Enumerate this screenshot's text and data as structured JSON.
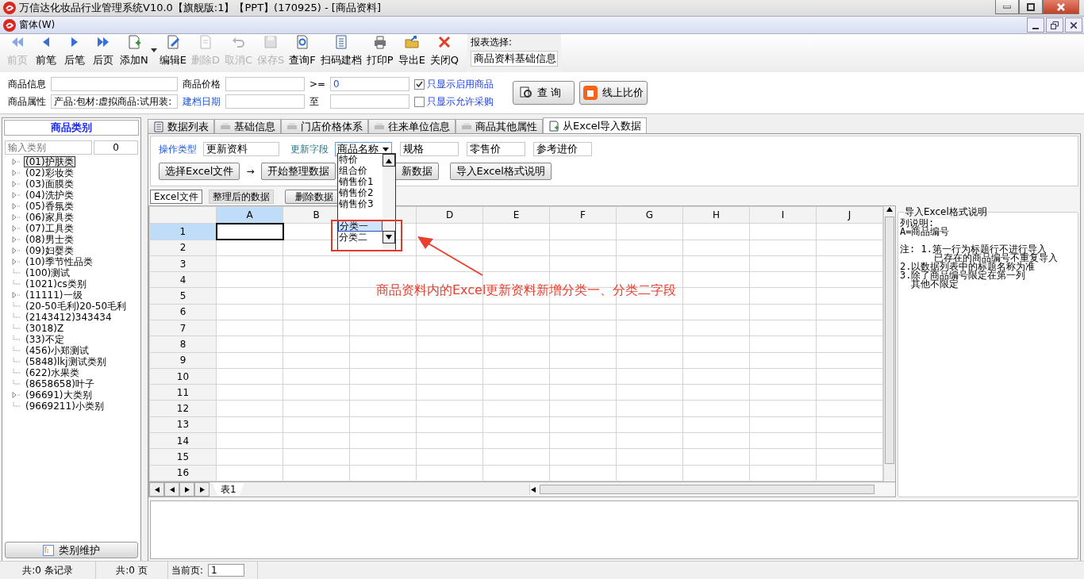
{
  "window": {
    "title": "万信达化妆品行业管理系统V10.0【旗舰版:1】【PPT】(170925) - [商品资料]"
  },
  "menu": {
    "label": "窗体(W)"
  },
  "toolbar": [
    {
      "kind": "first",
      "label": "前页",
      "disabled": true
    },
    {
      "kind": "prev",
      "label": "前笔",
      "disabled": false
    },
    {
      "kind": "next",
      "label": "后笔",
      "disabled": false
    },
    {
      "kind": "last",
      "label": "后页",
      "disabled": false
    },
    {
      "kind": "add",
      "label": "添加N",
      "disabled": false
    },
    {
      "kind": "edit",
      "label": "编辑E",
      "disabled": false
    },
    {
      "kind": "delete",
      "label": "删除D",
      "disabled": true
    },
    {
      "kind": "undo",
      "label": "取消C",
      "disabled": true
    },
    {
      "kind": "save",
      "label": "保存S",
      "disabled": true
    },
    {
      "kind": "query",
      "label": "查询F",
      "disabled": false
    },
    {
      "kind": "scan",
      "label": "扫码建档",
      "disabled": false
    },
    {
      "kind": "print",
      "label": "打印P",
      "disabled": false
    },
    {
      "kind": "export",
      "label": "导出E",
      "disabled": false
    },
    {
      "kind": "close",
      "label": "关闭Q",
      "disabled": false
    }
  ],
  "report_select": {
    "label": "报表选择:",
    "value": "商品资料基础信息"
  },
  "filters": {
    "info_label": "商品信息",
    "price_label": "商品价格",
    "ge": ">=",
    "ge_value": "0",
    "attr_label": "商品属性",
    "attr_value": "产品:包材:虚拟商品:试用装:",
    "date_label": "建档日期",
    "to": "至",
    "checks": [
      {
        "label": "只显示启用商品",
        "checked": true
      },
      {
        "label": "只显示允许采购",
        "checked": false
      }
    ],
    "query_button": "查  询",
    "compare_button": "线上比价"
  },
  "sidebar": {
    "title": "商品类别",
    "search_placeholder": "输入类别",
    "count": "0",
    "items": [
      {
        "label": "(01)护肤类",
        "kind": "folder",
        "selected": true
      },
      {
        "label": "(02)彩妆类",
        "kind": "folder",
        "selected": false
      },
      {
        "label": "(03)面膜类",
        "kind": "folder",
        "selected": false
      },
      {
        "label": "(04)洗护类",
        "kind": "folder",
        "selected": false
      },
      {
        "label": "(05)香氛类",
        "kind": "folder",
        "selected": false
      },
      {
        "label": "(06)家具类",
        "kind": "folder",
        "selected": false
      },
      {
        "label": "(07)工具类",
        "kind": "folder",
        "selected": false
      },
      {
        "label": "(08)男士类",
        "kind": "folder",
        "selected": false
      },
      {
        "label": "(09)妇婴类",
        "kind": "folder",
        "selected": false
      },
      {
        "label": "(10)季节性品类",
        "kind": "folder",
        "selected": false
      },
      {
        "label": "(100)测试",
        "kind": "leaf",
        "selected": false
      },
      {
        "label": "(1021)cs类别",
        "kind": "leaf",
        "selected": false
      },
      {
        "label": "(11111)一级",
        "kind": "folder",
        "selected": false
      },
      {
        "label": "(20-50毛利)20-50毛利",
        "kind": "leaf",
        "selected": false
      },
      {
        "label": "(2143412)343434",
        "kind": "leaf",
        "selected": false
      },
      {
        "label": "(3018)Z",
        "kind": "leaf",
        "selected": false
      },
      {
        "label": "(33)不定",
        "kind": "leaf",
        "selected": false
      },
      {
        "label": "(456)小郑测试",
        "kind": "leaf",
        "selected": false
      },
      {
        "label": "(5848)lkj测试类别",
        "kind": "leaf",
        "selected": false
      },
      {
        "label": "(622)水果类",
        "kind": "leaf",
        "selected": false
      },
      {
        "label": "(8658658)叶子",
        "kind": "leaf",
        "selected": false
      },
      {
        "label": "(96691)大类别",
        "kind": "folder",
        "selected": false
      },
      {
        "label": "(9669211)小类别",
        "kind": "leaf",
        "selected": false
      }
    ],
    "maintain_button": "类别维护"
  },
  "tabs": [
    {
      "label": "数据列表",
      "selected": false
    },
    {
      "label": "基础信息",
      "selected": false
    },
    {
      "label": "门店价格体系",
      "selected": false
    },
    {
      "label": "往来单位信息",
      "selected": false
    },
    {
      "label": "商品其他属性",
      "selected": false
    },
    {
      "label": "从Excel导入数据",
      "selected": true
    }
  ],
  "import": {
    "op_label": "操作类型",
    "op_value": "更新资料",
    "field_label": "更新字段",
    "field_value": "商品名称",
    "extra_fields": [
      "规格",
      "零售价",
      "参考进价"
    ],
    "dropdown": [
      {
        "label": "特价",
        "selected": false
      },
      {
        "label": "组合价",
        "selected": false
      },
      {
        "label": "销售价1",
        "selected": false
      },
      {
        "label": "销售价2",
        "selected": false
      },
      {
        "label": "销售价3",
        "selected": false
      },
      {
        "label": "分类一",
        "selected": true
      },
      {
        "label": "分类二",
        "selected": false
      }
    ],
    "buttons": [
      "选择Excel文件",
      "开始整理数据",
      "新数据",
      "导入Excel格式说明"
    ],
    "arrow": "→",
    "subtabs": [
      {
        "label": "Excel文件",
        "selected": true
      },
      {
        "label": "整理后的数据",
        "selected": false
      }
    ],
    "delete_button": "删除数据"
  },
  "sheet": {
    "columns": [
      {
        "label": "A",
        "selected": true
      },
      {
        "label": "B",
        "selected": false
      },
      {
        "selected": false
      },
      {
        "label": "D",
        "selected": false
      },
      {
        "label": "E",
        "selected": false
      },
      {
        "label": "F",
        "selected": false
      },
      {
        "label": "G",
        "selected": false
      },
      {
        "label": "H",
        "selected": false
      },
      {
        "label": "I",
        "selected": false
      },
      {
        "label": "J",
        "selected": false
      }
    ],
    "rows": [
      {
        "label": "1",
        "selected": true
      },
      {
        "label": "2",
        "selected": false
      },
      {
        "label": "3",
        "selected": false
      },
      {
        "label": "4",
        "selected": false
      },
      {
        "label": "5",
        "selected": false
      },
      {
        "label": "6",
        "selected": false
      },
      {
        "label": "7",
        "selected": false
      },
      {
        "label": "8",
        "selected": false
      },
      {
        "label": "9",
        "selected": false
      },
      {
        "label": "10",
        "selected": false
      },
      {
        "label": "11",
        "selected": false
      },
      {
        "label": "12",
        "selected": false
      },
      {
        "label": "13",
        "selected": false
      },
      {
        "label": "14",
        "selected": false
      },
      {
        "label": "15",
        "selected": false
      },
      {
        "label": "16",
        "selected": false
      }
    ],
    "sheet_tab": "表1"
  },
  "help": {
    "title": "导入Excel格式说明",
    "sections": [
      [
        "列说明:",
        "A=商品编号"
      ],
      [
        "注: 1.第一行为标题行不进行导入",
        "      已存在的商品编号不重复导入",
        "2.以数据列表中的标题名称为准",
        "3.除了商品编号限定在第一列",
        "  其他不限定"
      ]
    ]
  },
  "annotation": {
    "text": "商品资料内的Excel更新资料新增分类一、分类二字段"
  },
  "status": {
    "records": "共:0 条记录",
    "pages": "共:0 页",
    "current_label": "当前页:",
    "current_value": "1"
  }
}
